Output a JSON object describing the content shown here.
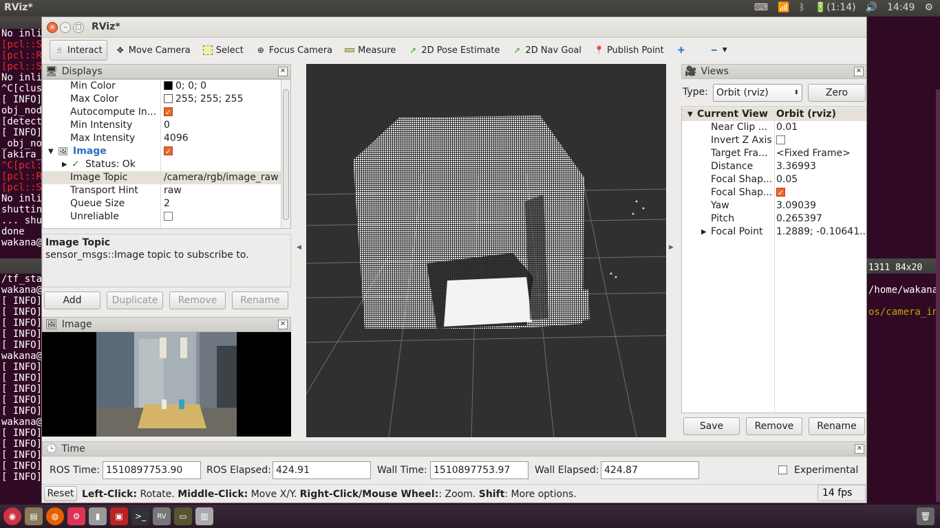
{
  "topbar": {
    "title": "RViz*",
    "battery": "(1:14)",
    "clock": "14:49"
  },
  "terminal1": {
    "lines": [
      {
        "t": "No inlie",
        "c": ""
      },
      {
        "t": "[pcl::S",
        "c": "red"
      },
      {
        "t": "[pcl::R",
        "c": "red"
      },
      {
        "t": "[pcl::S",
        "c": "red"
      },
      {
        "t": "No inlie",
        "c": ""
      },
      {
        "t": "^C[clust",
        "c": ""
      },
      {
        "t": "[ INFO]",
        "c": ""
      },
      {
        "t": "obj_node",
        "c": ""
      },
      {
        "t": "[detecto",
        "c": ""
      },
      {
        "t": "[ INFO]",
        "c": ""
      },
      {
        "t": "_obj_noo",
        "c": ""
      },
      {
        "t": "[akira_",
        "c": ""
      },
      {
        "t": "^C[pcl:",
        "c": "red"
      },
      {
        "t": "[pcl::R",
        "c": "red"
      },
      {
        "t": "[pcl::S",
        "c": "red"
      },
      {
        "t": "No inlie",
        "c": ""
      },
      {
        "t": "shuttin",
        "c": ""
      },
      {
        "t": "... shut",
        "c": ""
      },
      {
        "t": "done",
        "c": ""
      },
      {
        "t": "wakana@",
        "c": ""
      }
    ]
  },
  "terminal2": {
    "title": "1311 84x20",
    "lines": [
      {
        "t": "/tf_sta",
        "c": ""
      },
      {
        "t": "wakana@",
        "c": ""
      },
      {
        "t": "[ INFO]",
        "c": ""
      },
      {
        "t": "[ INFO]",
        "c": ""
      },
      {
        "t": "[ INFO]",
        "c": ""
      },
      {
        "t": "[ INFO]",
        "c": ""
      },
      {
        "t": "[ INFO]",
        "c": ""
      },
      {
        "t": "wakana@",
        "c": ""
      },
      {
        "t": "[ INFO]",
        "c": ""
      },
      {
        "t": "[ INFO]",
        "c": ""
      },
      {
        "t": "[ INFO]",
        "c": ""
      },
      {
        "t": "[ INFO]",
        "c": ""
      },
      {
        "t": "[ INFO]",
        "c": ""
      },
      {
        "t": "wakana@",
        "c": ""
      },
      {
        "t": "[ INFO]",
        "c": ""
      },
      {
        "t": "[ INFO]",
        "c": ""
      },
      {
        "t": "[ INFO]",
        "c": ""
      },
      {
        "t": "[ INFO]",
        "c": ""
      },
      {
        "t": "[ INFO]",
        "c": ""
      }
    ],
    "right1": "/home/wakana",
    "right2": "os/camera_inf"
  },
  "window": {
    "title": "RViz*"
  },
  "toolbar": {
    "interact": "Interact",
    "move_camera": "Move Camera",
    "select": "Select",
    "focus_camera": "Focus Camera",
    "measure": "Measure",
    "pose": "2D Pose Estimate",
    "nav": "2D Nav Goal",
    "publish": "Publish Point",
    "plus": "✚",
    "minus": "━"
  },
  "displays": {
    "title": "Displays",
    "rows": [
      {
        "k": "Min Color",
        "v": "0; 0; 0"
      },
      {
        "k": "Max Color",
        "v": "255; 255; 255"
      },
      {
        "k": "Autocompute In...",
        "v": ""
      },
      {
        "k": "Min Intensity",
        "v": "0"
      },
      {
        "k": "Max Intensity",
        "v": "4096"
      },
      {
        "k": "Image",
        "v": ""
      },
      {
        "k": "Status: Ok",
        "v": ""
      },
      {
        "k": "Image Topic",
        "v": "/camera/rgb/image_raw"
      },
      {
        "k": "Transport Hint",
        "v": "raw"
      },
      {
        "k": "Queue Size",
        "v": "2"
      },
      {
        "k": "Unreliable",
        "v": ""
      }
    ],
    "desc_title": "Image Topic",
    "desc_text": "sensor_msgs::Image topic to subscribe to.",
    "add": "Add",
    "duplicate": "Duplicate",
    "remove": "Remove",
    "rename": "Rename"
  },
  "image_panel": {
    "title": "Image"
  },
  "views": {
    "title": "Views",
    "type_label": "Type:",
    "type_value": "Orbit (rviz)",
    "zero": "Zero",
    "header_k": "Current View",
    "header_v": "Orbit (rviz)",
    "rows": [
      {
        "k": "Near Clip ...",
        "v": "0.01"
      },
      {
        "k": "Invert Z Axis",
        "v": ""
      },
      {
        "k": "Target Fra...",
        "v": "<Fixed Frame>"
      },
      {
        "k": "Distance",
        "v": "3.36993"
      },
      {
        "k": "Focal Shap...",
        "v": "0.05"
      },
      {
        "k": "Focal Shap...",
        "v": ""
      },
      {
        "k": "Yaw",
        "v": "3.09039"
      },
      {
        "k": "Pitch",
        "v": "0.265397"
      },
      {
        "k": "Focal Point",
        "v": "1.2889; -0.10641..."
      }
    ],
    "save": "Save",
    "remove": "Remove",
    "rename": "Rename"
  },
  "time": {
    "title": "Time",
    "ros_time_label": "ROS Time:",
    "ros_time": "1510897753.90",
    "ros_elapsed_label": "ROS Elapsed:",
    "ros_elapsed": "424.91",
    "wall_time_label": "Wall Time:",
    "wall_time": "1510897753.97",
    "wall_elapsed_label": "Wall Elapsed:",
    "wall_elapsed": "424.87",
    "experimental": "Experimental"
  },
  "status": {
    "reset": "Reset",
    "b1": "Left-Click:",
    "t1": " Rotate. ",
    "b2": "Middle-Click:",
    "t2": " Move X/Y. ",
    "b3": "Right-Click/Mouse Wheel:",
    "t3": ": Zoom. ",
    "b4": "Shift",
    "t4": ": More options.",
    "fps": "14 fps"
  }
}
